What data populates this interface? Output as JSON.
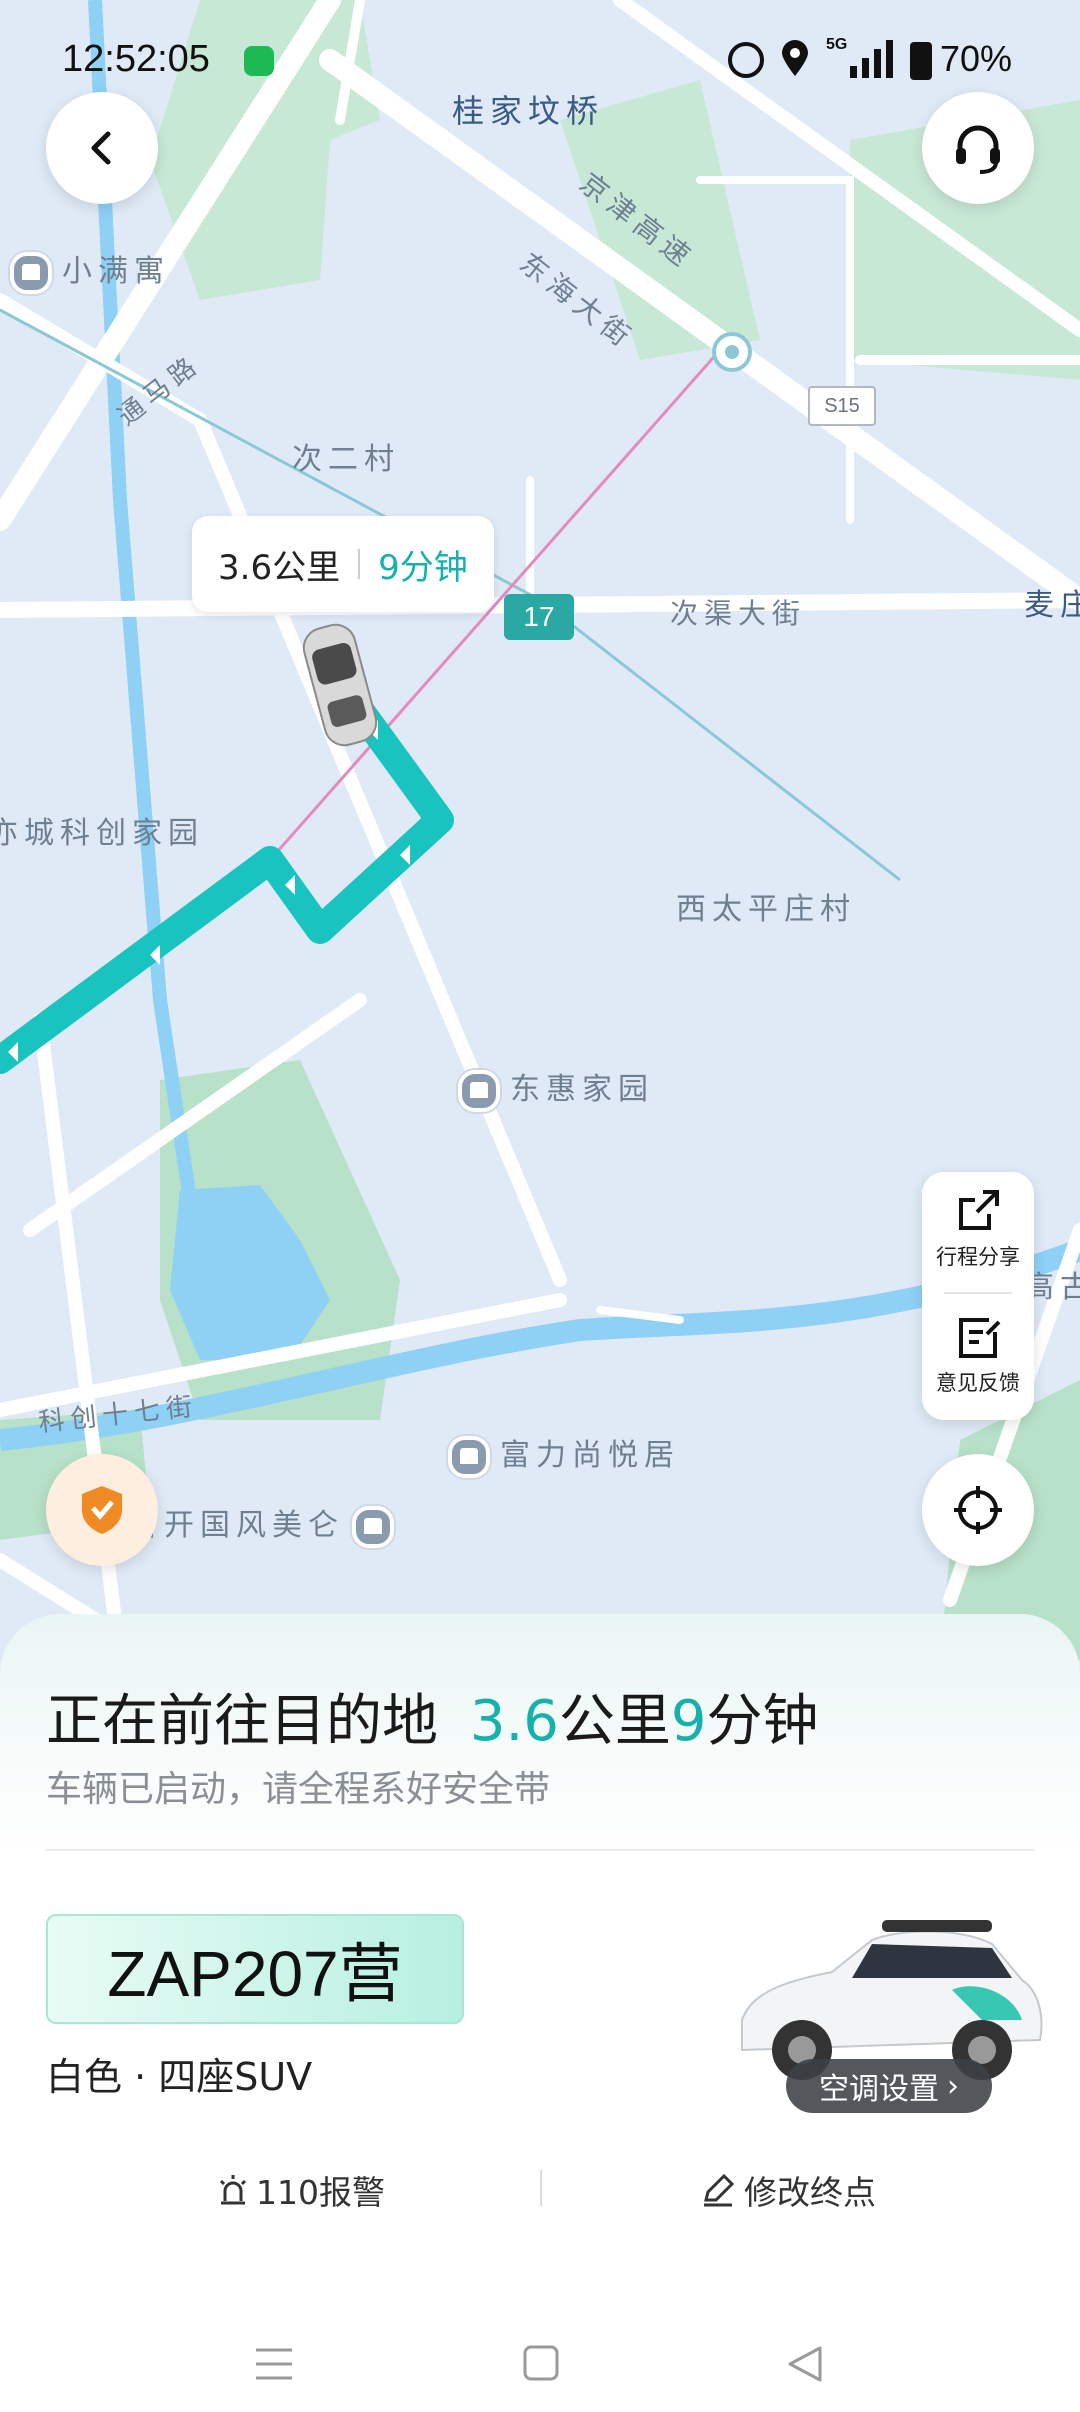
{
  "status_bar": {
    "time": "12:52:05",
    "network": "5G",
    "battery": "70%"
  },
  "map": {
    "labels": {
      "guijiafenqiao": "桂家坟桥",
      "jingjin": "京津高速",
      "donghai": "东海大街",
      "xiaoman": "小满寓",
      "tongma": "通马路",
      "ciercun": "次二村",
      "s15": "S15",
      "route17": "17",
      "ciqu": "次渠大街",
      "maizhuang": "麦庄",
      "yicheng": "亦城科创家园",
      "xitaiping": "西太平庄村",
      "donghui": "东惠家园",
      "gaogu": "高古",
      "kechuang17": "科创十七街",
      "fuli": "富力尚悦居",
      "kaiguo": "首开国风美仑"
    }
  },
  "bubble": {
    "distance": "3.6公里",
    "duration": "9分钟"
  },
  "side_panel": {
    "share": "行程分享",
    "feedback": "意见反馈"
  },
  "sheet": {
    "title_prefix": "正在前往目的地",
    "distance_num": "3.6",
    "distance_unit": "公里",
    "time_num": "9",
    "time_unit": "分钟",
    "subtitle": "车辆已启动，请全程系好安全带",
    "plate": "ZAP207营",
    "car_desc": "白色 · 四座SUV",
    "ac_button": "空调设置",
    "alarm": "110报警",
    "change_dest": "修改终点"
  },
  "colors": {
    "accent": "#14b1ad",
    "route": "#18c3c0",
    "water": "#8fd0f5",
    "green": "#b7e1c8"
  }
}
